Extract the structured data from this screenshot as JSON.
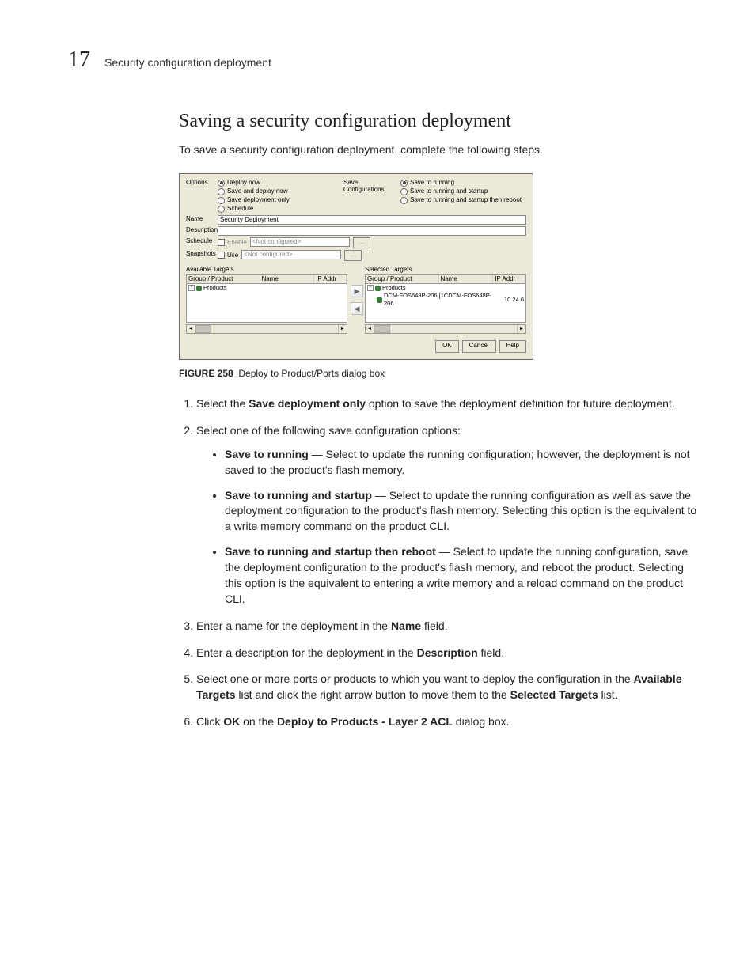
{
  "header": {
    "chapter_number": "17",
    "running_head": "Security configuration deployment"
  },
  "section": {
    "title": "Saving a security configuration deployment",
    "intro": "To save a security configuration deployment, complete the following steps."
  },
  "dialog": {
    "options_label": "Options",
    "save_config_label": "Save Configurations",
    "options": {
      "deploy_now": "Deploy now",
      "save_and_deploy": "Save and deploy now",
      "save_only": "Save deployment only",
      "schedule": "Schedule"
    },
    "save_config": {
      "running": "Save to running",
      "run_startup": "Save to running and startup",
      "run_startup_reboot": "Save to running and startup then reboot"
    },
    "name_label": "Name",
    "name_value": "Security Deployment",
    "description_label": "Description",
    "schedule_label": "Schedule",
    "enable_label": "Enable",
    "snapshots_label": "Snapshots",
    "use_label": "Use",
    "not_configured": "<Not configured>",
    "available_title": "Available Targets",
    "selected_title": "Selected Targets",
    "cols": {
      "group": "Group / Product",
      "name": "Name",
      "ip": "IP Addr"
    },
    "available_root": "Products",
    "selected_root": "Products",
    "selected_item_group": "DCM-FOS648P-206 [1CDCM-FOS648P-206",
    "selected_item_ip": "10.24.6",
    "buttons": {
      "ok": "OK",
      "cancel": "Cancel",
      "help": "Help"
    },
    "move_right": "▶",
    "move_left": "◀",
    "scroll_left": "◄",
    "scroll_right": "►"
  },
  "figure": {
    "label": "FIGURE 258",
    "caption": "Deploy to Product/Ports dialog box"
  },
  "steps": {
    "s1a": "Select the ",
    "s1b": "Save deployment only",
    "s1c": " option to save the deployment definition for future deployment.",
    "s2": "Select one of the following save configuration options:",
    "b1_term": "Save to running",
    "b1_txt": " — Select to update the running configuration; however, the deployment is not saved to the product's flash memory.",
    "b2_term": "Save to running and startup",
    "b2_txt": " — Select to update the running configuration as well as save the deployment configuration to the product's flash memory. Selecting this option is the equivalent to a write memory command on the product CLI.",
    "b3_term": "Save to running and startup then reboot",
    "b3_txt": " — Select to update the running configuration, save the deployment configuration to the product's flash memory, and reboot the product. Selecting this option is the equivalent to entering a write memory and a reload command on the product CLI.",
    "s3a": "Enter a name for the deployment in the ",
    "s3b": "Name",
    "s3c": " field.",
    "s4a": "Enter a description for the deployment in the ",
    "s4b": "Description",
    "s4c": " field.",
    "s5a": "Select one or more ports or products to which you want to deploy the configuration in the ",
    "s5b": "Available Targets",
    "s5c": " list and click the right arrow button to move them to the ",
    "s5d": "Selected Targets",
    "s5e": " list.",
    "s6a": "Click ",
    "s6b": "OK",
    "s6c": " on the ",
    "s6d": "Deploy to Products - Layer 2 ACL",
    "s6e": " dialog box."
  }
}
